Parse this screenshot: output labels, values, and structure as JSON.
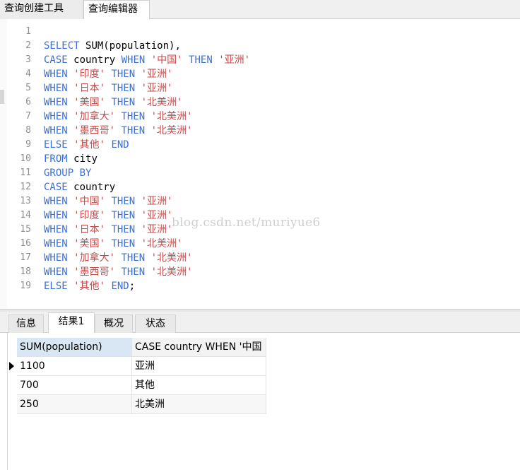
{
  "top_tabs": [
    "查询创建工具",
    "查询编辑器"
  ],
  "editor": {
    "line_numbers": [
      "1",
      "2",
      "3",
      "4",
      "5",
      "6",
      "7",
      "8",
      "9",
      "10",
      "11",
      "12",
      "13",
      "14",
      "15",
      "16",
      "17",
      "18",
      "19"
    ],
    "lines": [
      [],
      [
        [
          "kw",
          "SELECT "
        ],
        [
          "id",
          "SUM(population),"
        ]
      ],
      [
        [
          "kw",
          "CASE "
        ],
        [
          "id",
          "country "
        ],
        [
          "kw",
          "WHEN "
        ],
        [
          "str",
          "'中国' "
        ],
        [
          "kw",
          "THEN "
        ],
        [
          "str",
          "'亚洲'"
        ]
      ],
      [
        [
          "kw",
          "WHEN "
        ],
        [
          "str",
          "'印度' "
        ],
        [
          "kw",
          "THEN "
        ],
        [
          "str",
          "'亚洲'"
        ]
      ],
      [
        [
          "kw",
          "WHEN "
        ],
        [
          "str",
          "'日本' "
        ],
        [
          "kw",
          "THEN "
        ],
        [
          "str",
          "'亚洲'"
        ]
      ],
      [
        [
          "kw",
          "WHEN "
        ],
        [
          "str",
          "'美国' "
        ],
        [
          "kw",
          "THEN "
        ],
        [
          "str",
          "'北美洲'"
        ]
      ],
      [
        [
          "kw",
          "WHEN "
        ],
        [
          "str",
          "'加拿大' "
        ],
        [
          "kw",
          "THEN "
        ],
        [
          "str",
          "'北美洲'"
        ]
      ],
      [
        [
          "kw",
          "WHEN "
        ],
        [
          "str",
          "'墨西哥' "
        ],
        [
          "kw",
          "THEN "
        ],
        [
          "str",
          "'北美洲'"
        ]
      ],
      [
        [
          "kw",
          "ELSE "
        ],
        [
          "str",
          "'其他' "
        ],
        [
          "kw",
          "END"
        ]
      ],
      [
        [
          "kw",
          "FROM "
        ],
        [
          "id",
          "city"
        ]
      ],
      [
        [
          "kw",
          "GROUP BY"
        ]
      ],
      [
        [
          "kw",
          "CASE "
        ],
        [
          "id",
          "country"
        ]
      ],
      [
        [
          "kw",
          "WHEN "
        ],
        [
          "str",
          "'中国' "
        ],
        [
          "kw",
          "THEN "
        ],
        [
          "str",
          "'亚洲'"
        ]
      ],
      [
        [
          "kw",
          "WHEN "
        ],
        [
          "str",
          "'印度' "
        ],
        [
          "kw",
          "THEN "
        ],
        [
          "str",
          "'亚洲'"
        ]
      ],
      [
        [
          "kw",
          "WHEN "
        ],
        [
          "str",
          "'日本' "
        ],
        [
          "kw",
          "THEN "
        ],
        [
          "str",
          "'亚洲'"
        ]
      ],
      [
        [
          "kw",
          "WHEN "
        ],
        [
          "str",
          "'美国' "
        ],
        [
          "kw",
          "THEN "
        ],
        [
          "str",
          "'北美洲'"
        ]
      ],
      [
        [
          "kw",
          "WHEN "
        ],
        [
          "str",
          "'加拿大' "
        ],
        [
          "kw",
          "THEN "
        ],
        [
          "str",
          "'北美洲'"
        ]
      ],
      [
        [
          "kw",
          "WHEN "
        ],
        [
          "str",
          "'墨西哥' "
        ],
        [
          "kw",
          "THEN "
        ],
        [
          "str",
          "'北美洲'"
        ]
      ],
      [
        [
          "kw",
          "ELSE "
        ],
        [
          "str",
          "'其他' "
        ],
        [
          "kw",
          "END"
        ],
        [
          "id",
          ";"
        ]
      ]
    ],
    "watermark": "blog.csdn.net/muriyue6"
  },
  "result_tabs": [
    "信息",
    "结果1",
    "概况",
    "状态"
  ],
  "grid": {
    "columns": [
      "SUM(population)",
      "CASE country WHEN '中国"
    ],
    "rows": [
      [
        "1100",
        "亚洲"
      ],
      [
        "700",
        "其他"
      ],
      [
        "250",
        "北美洲"
      ]
    ]
  },
  "colors": {
    "keyword": "#3a6fd8",
    "string": "#c84848",
    "identifier": "#000000"
  }
}
